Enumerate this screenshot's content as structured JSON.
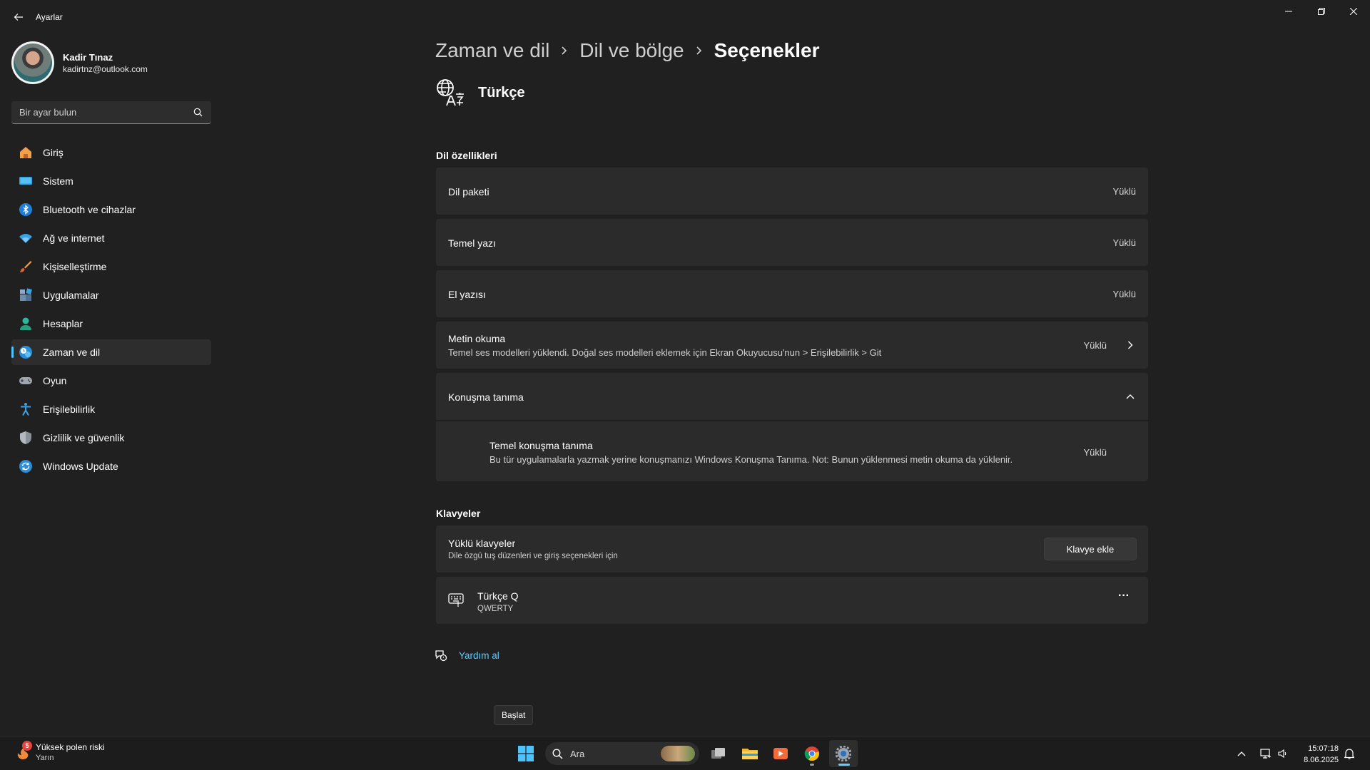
{
  "window": {
    "title": "Ayarlar"
  },
  "profile": {
    "name": "Kadir Tınaz",
    "email": "kadirtnz@outlook.com"
  },
  "search": {
    "placeholder": "Bir ayar bulun"
  },
  "sidebar": {
    "items": [
      {
        "label": "Giriş",
        "icon": "home-icon"
      },
      {
        "label": "Sistem",
        "icon": "system-icon"
      },
      {
        "label": "Bluetooth ve cihazlar",
        "icon": "bluetooth-icon"
      },
      {
        "label": "Ağ ve internet",
        "icon": "wifi-icon"
      },
      {
        "label": "Kişiselleştirme",
        "icon": "brush-icon"
      },
      {
        "label": "Uygulamalar",
        "icon": "apps-icon"
      },
      {
        "label": "Hesaplar",
        "icon": "account-icon"
      },
      {
        "label": "Zaman ve dil",
        "icon": "time-language-icon",
        "selected": true
      },
      {
        "label": "Oyun",
        "icon": "gamepad-icon"
      },
      {
        "label": "Erişilebilirlik",
        "icon": "accessibility-icon"
      },
      {
        "label": "Gizlilik ve güvenlik",
        "icon": "shield-icon"
      },
      {
        "label": "Windows Update",
        "icon": "update-icon"
      }
    ]
  },
  "breadcrumb": {
    "items": [
      "Zaman ve dil",
      "Dil ve bölge",
      "Seçenekler"
    ]
  },
  "language": {
    "name": "Türkçe"
  },
  "language_features": {
    "title": "Dil özellikleri",
    "rows": [
      {
        "title": "Dil paketi",
        "status": "Yüklü"
      },
      {
        "title": "Temel yazı",
        "status": "Yüklü"
      },
      {
        "title": "El yazısı",
        "status": "Yüklü"
      },
      {
        "title": "Metin okuma",
        "subtitle": "Temel ses modelleri yüklendi. Doğal ses modelleri eklemek için Ekran Okuyucusu'nun > Erişilebilirlik > Git",
        "status": "Yüklü"
      }
    ],
    "speech": {
      "title": "Konuşma tanıma",
      "sub_title": "Temel konuşma tanıma",
      "sub_text": "Bu tür uygulamalarla yazmak yerine konuşmanızı Windows Konuşma Tanıma. Not: Bunun yüklenmesi metin okuma da yüklenir.",
      "status": "Yüklü"
    }
  },
  "keyboards": {
    "title": "Klavyeler",
    "installed_title": "Yüklü klavyeler",
    "installed_sub": "Dile özgü tuş düzenleri ve giriş seçenekleri için",
    "add_button": "Klavye ekle",
    "keyboard_name": "Türkçe Q",
    "keyboard_layout": "QWERTY",
    "more": "···"
  },
  "help": {
    "label": "Yardım al"
  },
  "tooltip": {
    "text": "Başlat"
  },
  "taskbar": {
    "weather_title": "Yüksek polen riski",
    "weather_sub": "Yarın",
    "weather_badge": "5",
    "search_label": "Ara",
    "time": "15:07:18",
    "date": "8.06.2025"
  },
  "colors": {
    "accent": "#4cc2ff",
    "link": "#60cdff",
    "background": "#202020",
    "card": "#2b2b2b"
  }
}
